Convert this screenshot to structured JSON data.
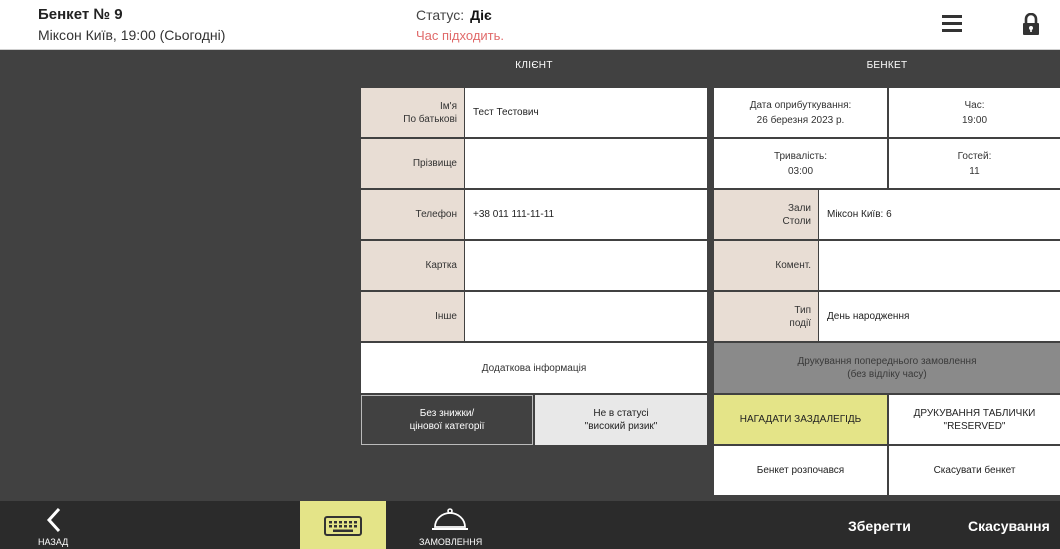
{
  "header": {
    "title": "Бенкет № 9",
    "subtitle": "Міксон Київ, 19:00 (Сьогодні)",
    "status_label": "Статус:",
    "status_value": "Діє",
    "warning": "Час підходить."
  },
  "client": {
    "heading": "КЛІЄНТ",
    "name_label_1": "Ім'я",
    "name_label_2": "По батькові",
    "name_value": "Тест Тестович",
    "surname_label": "Прізвище",
    "surname_value": "",
    "phone_label": "Телефон",
    "phone_value": "+38 011 111-11-11",
    "card_label": "Картка",
    "card_value": "",
    "other_label": "Інше",
    "other_value": "",
    "extra_info": "Додаткова інформація",
    "no_discount_1": "Без знижки/",
    "no_discount_2": "цінової категорії",
    "not_risk_1": "Не в статусі",
    "not_risk_2": "\"високий ризик\""
  },
  "banquet": {
    "heading": "БЕНКЕТ",
    "pub_date_label": "Дата оприбуткування:",
    "pub_date_value": "26 березня 2023 р.",
    "time_label": "Час:",
    "time_value": "19:00",
    "duration_label": "Тривалість:",
    "duration_value": "03:00",
    "guests_label": "Гостей:",
    "guests_value": "11",
    "halls_label_1": "Зали",
    "halls_label_2": "Столи",
    "halls_value": "Міксон Київ: 6",
    "comment_label": "Комент.",
    "comment_value": "",
    "event_label_1": "Тип",
    "event_label_2": "події",
    "event_value": "День народження",
    "print_preorder_1": "Друкування попереднього замовлення",
    "print_preorder_2": "(без відліку часу)",
    "remind": "НАГАДАТИ ЗАЗДАЛЕГІДЬ",
    "print_reserved_1": "ДРУКУВАННЯ ТАБЛИЧКИ",
    "print_reserved_2": "\"RESERVED\"",
    "started": "Бенкет розпочався",
    "cancel_banquet": "Скасувати бенкет"
  },
  "bottom": {
    "back": "НАЗАД",
    "orders": "ЗАМОВЛЕННЯ",
    "save": "Зберегти",
    "cancel": "Скасування"
  },
  "colors": {
    "label_bg": "#e8ddd4",
    "accent_yellow": "#e4e488",
    "dark_bg": "#414141",
    "warning": "#e06a6a"
  },
  "icons": [
    "hamburger-menu-icon",
    "lock-icon",
    "back-arrow-icon",
    "keyboard-icon",
    "cloche-icon"
  ]
}
